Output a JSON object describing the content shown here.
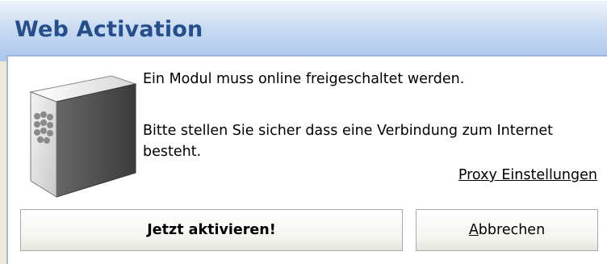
{
  "window": {
    "title": "Web Activation"
  },
  "icon": {
    "name": "module-server-icon"
  },
  "message": {
    "line1": "Ein Modul muss online freigeschaltet werden.",
    "line2": "Bitte stellen Sie sicher dass eine Verbindung zum Internet besteht."
  },
  "links": {
    "proxy_label": "Proxy Einstellungen"
  },
  "buttons": {
    "activate_label": "Jetzt aktivieren!",
    "cancel_accel": "A",
    "cancel_rest": "bbrechen"
  },
  "colors": {
    "title_text": "#254e8c",
    "content_border": "#9fb7d9",
    "window_bg": "#ece9d8"
  }
}
